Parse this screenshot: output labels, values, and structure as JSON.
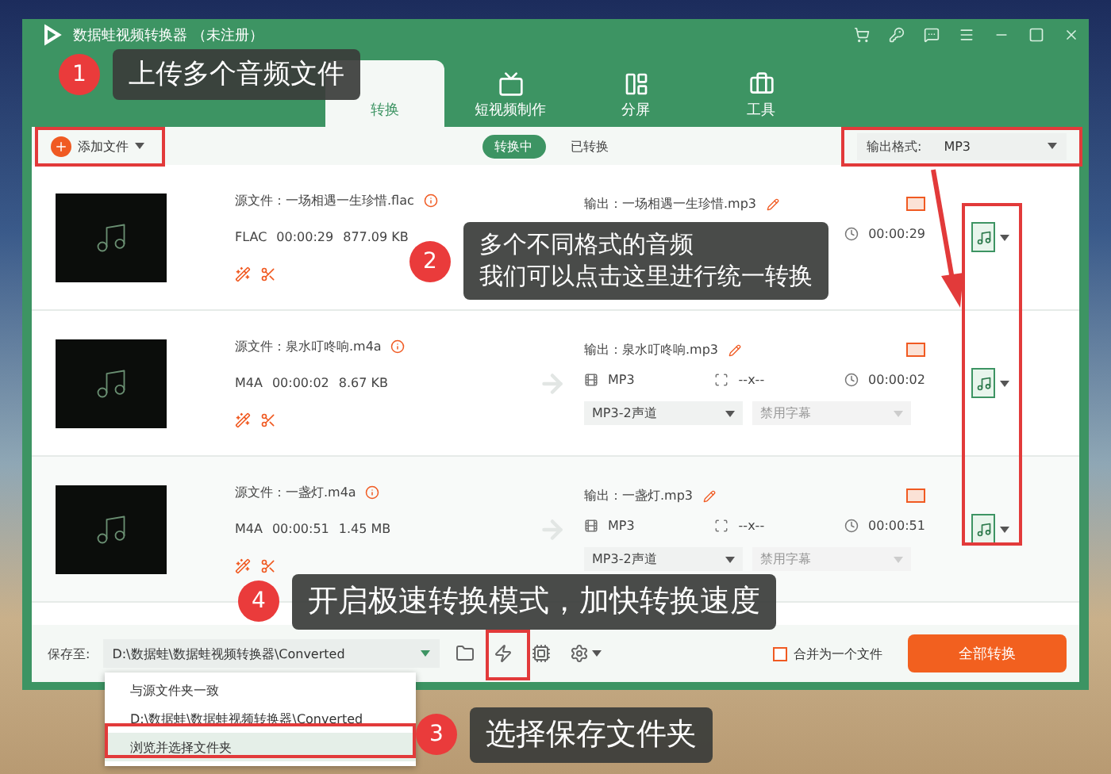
{
  "window": {
    "title": "数据蛙视频转换器 （未注册）"
  },
  "header_tabs": [
    {
      "label": "转换",
      "kind": "convert",
      "selected": true
    },
    {
      "label": "短视频制作",
      "kind": "video",
      "selected": false
    },
    {
      "label": "分屏",
      "kind": "split",
      "selected": false
    },
    {
      "label": "工具",
      "kind": "tools",
      "selected": false
    }
  ],
  "toolbar": {
    "add_button": "添加文件",
    "status_tabs": [
      {
        "label": "转换中",
        "selected": true
      },
      {
        "label": "已转换",
        "selected": false
      }
    ],
    "output_format": {
      "label": "输出格式:",
      "value": "MP3"
    }
  },
  "files": [
    {
      "source": "源文件：一场相遇一生珍惜.flac",
      "format": "FLAC",
      "duration": "00:00:29",
      "size": "877.09 KB",
      "output": "输出：一场相遇一生珍惜.mp3",
      "output_duration": "00:00:29"
    },
    {
      "source": "源文件：泉水叮咚响.m4a",
      "format": "M4A",
      "duration": "00:00:02",
      "size": "8.67 KB",
      "output": "输出：泉水叮咚响.mp3",
      "output_format": "MP3",
      "resolution": "--x--",
      "output_duration": "00:00:02",
      "audio": "MP3-2声道",
      "subtitle": "禁用字幕"
    },
    {
      "source": "源文件：一盏灯.m4a",
      "format": "M4A",
      "duration": "00:00:51",
      "size": "1.45 MB",
      "output": "输出：一盏灯.mp3",
      "output_format": "MP3",
      "resolution": "--x--",
      "output_duration": "00:00:51",
      "audio": "MP3-2声道",
      "subtitle": "禁用字幕"
    }
  ],
  "bottom": {
    "save_label": "保存至:",
    "save_path": "D:\\数据蛙\\数据蛙视频转换器\\Converted",
    "merge": {
      "label": "合并为一个文件",
      "checked": false
    },
    "convert_button": "全部转换"
  },
  "save_menu": [
    {
      "label": "与源文件夹一致",
      "selected": false
    },
    {
      "label": "D:\\数据蛙\\数据蛙视频转换器\\Converted",
      "selected": false
    },
    {
      "label": "浏览并选择文件夹",
      "selected": true
    }
  ],
  "callouts": [
    {
      "number": "1",
      "lines": [
        "上传多个音频文件"
      ]
    },
    {
      "number": "2",
      "lines": [
        "多个不同格式的音频",
        "我们可以点击这里进行统一转换"
      ]
    },
    {
      "number": "3",
      "lines": [
        "选择保存文件夹"
      ]
    },
    {
      "number": "4",
      "lines": [
        "开启极速转换模式，加快转换速度"
      ]
    }
  ]
}
